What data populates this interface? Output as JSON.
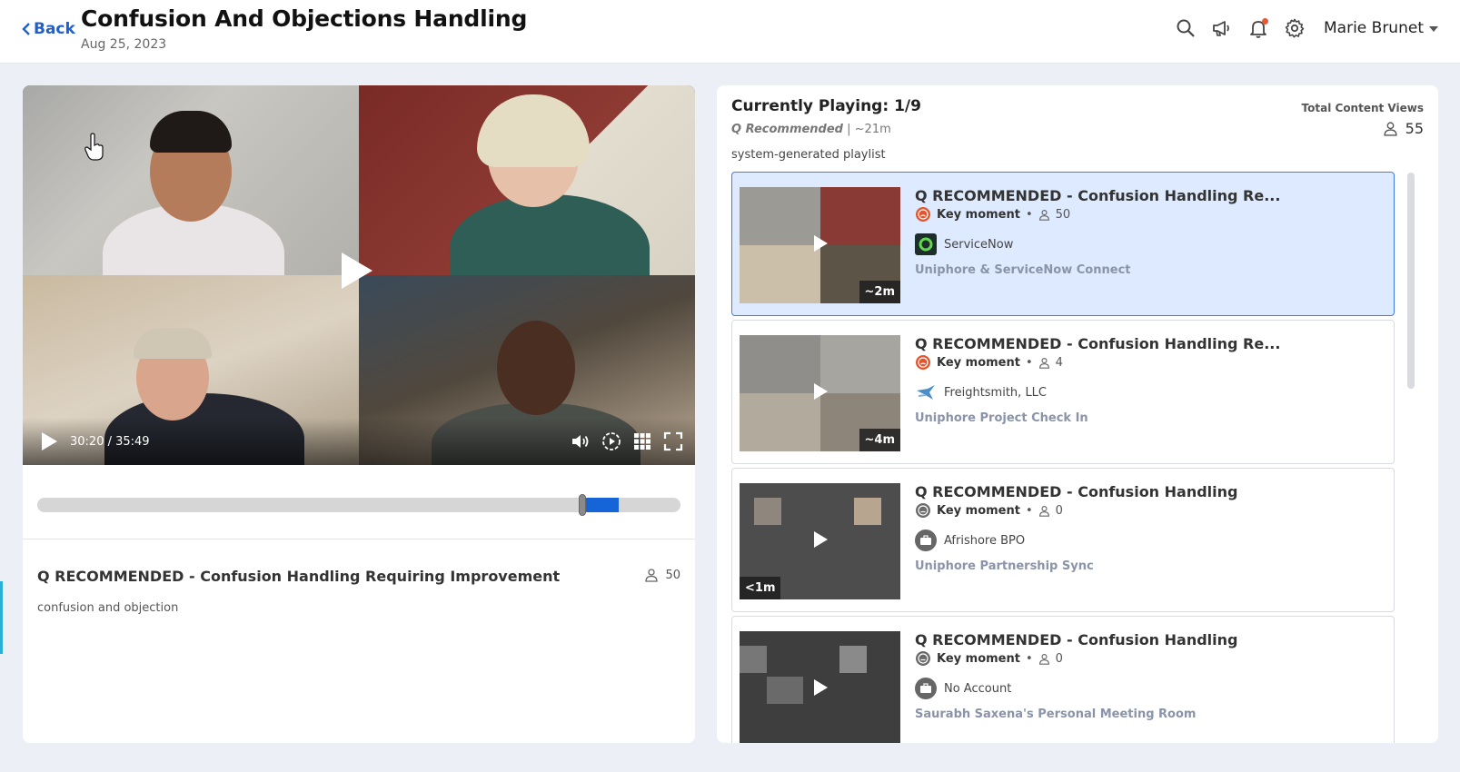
{
  "header": {
    "back_label": "Back",
    "title": "Confusion And Objections Handling",
    "date": "Aug 25, 2023",
    "user_name": "Marie Brunet",
    "icons": [
      "search-icon",
      "megaphone-icon",
      "bell-icon",
      "gear-icon"
    ]
  },
  "player": {
    "time": "30:20 / 35:49",
    "progress_fraction": 0.847
  },
  "clip": {
    "title": "Q RECOMMENDED - Confusion Handling Requiring Improvement",
    "views": "50",
    "description": "confusion and objection"
  },
  "playlist": {
    "currently_playing": "Currently Playing: 1/9",
    "source": "Q Recommended",
    "duration": "~21m",
    "type_label": "system-generated playlist",
    "total_views_label": "Total Content Views",
    "total_views": "55",
    "items": [
      {
        "title": "Q RECOMMENDED - Confusion Handling Re...",
        "tag": "Key moment",
        "views": "50",
        "account": "ServiceNow",
        "meeting": "Uniphore & ServiceNow Connect",
        "duration": "~2m",
        "active": true
      },
      {
        "title": "Q RECOMMENDED - Confusion Handling Re...",
        "tag": "Key moment",
        "views": "4",
        "account": "Freightsmith, LLC",
        "meeting": "Uniphore Project Check In",
        "duration": "~4m",
        "active": false
      },
      {
        "title": "Q RECOMMENDED - Confusion Handling",
        "tag": "Key moment",
        "views": "0",
        "account": "Afrishore BPO",
        "meeting": "Uniphore Partnership Sync",
        "duration": "<1m",
        "active": false
      },
      {
        "title": "Q RECOMMENDED - Confusion Handling",
        "tag": "Key moment",
        "views": "0",
        "account": "No Account",
        "meeting": "Saurabh Saxena's Personal Meeting Room",
        "duration": "",
        "active": false
      }
    ]
  },
  "colors": {
    "accent": "#1f5fcf",
    "active_bg": "#ddeaff",
    "timeline_fill": "#1565d8",
    "emotion_icon": "#e2552d"
  }
}
